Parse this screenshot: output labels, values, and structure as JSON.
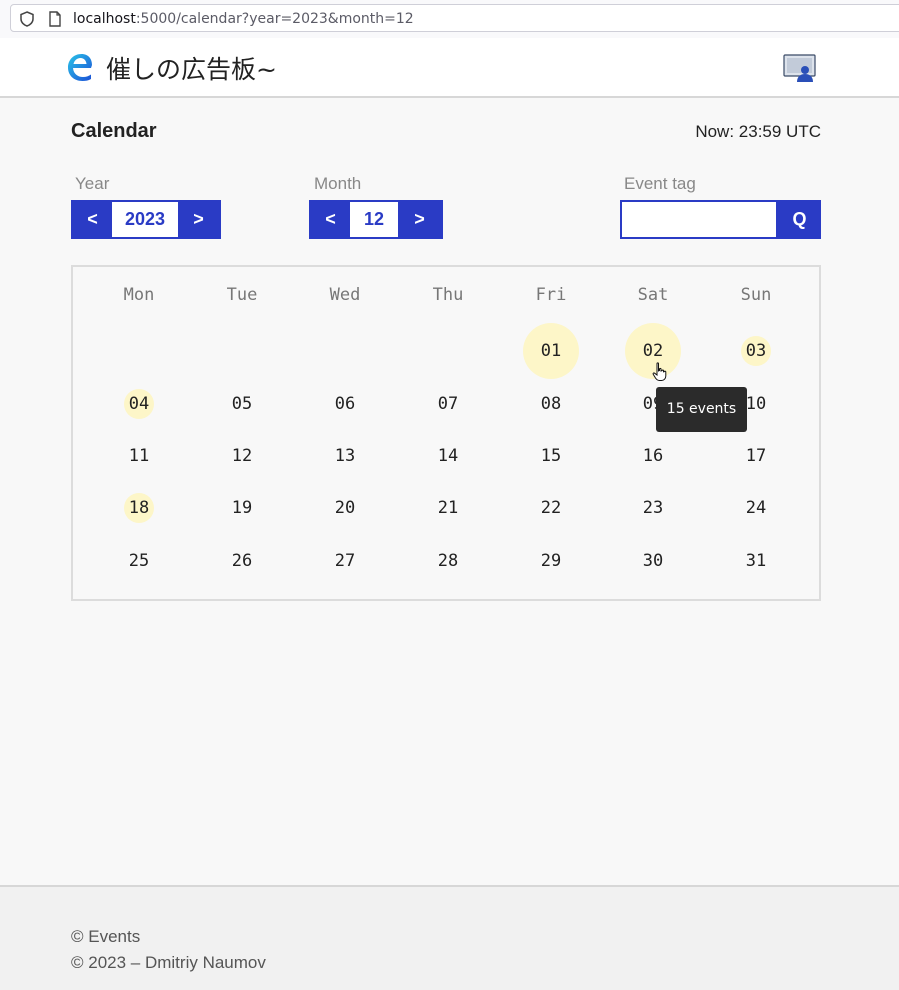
{
  "browser": {
    "url_host": "localhost",
    "url_rest": ":5000/calendar?year=2023&month=12"
  },
  "header": {
    "brand": "催しの広告板~"
  },
  "page": {
    "title": "Calendar",
    "now": "Now: 23:59 UTC"
  },
  "controls": {
    "year_label": "Year",
    "year_value": "2023",
    "month_label": "Month",
    "month_value": "12",
    "prev_label": "<",
    "next_label": ">",
    "tag_label": "Event tag",
    "tag_value": "",
    "search_label": "Q"
  },
  "calendar": {
    "weekdays": [
      "Mon",
      "Tue",
      "Wed",
      "Thu",
      "Fri",
      "Sat",
      "Sun"
    ],
    "weeks": [
      [
        "",
        "",
        "",
        "",
        "01",
        "02",
        "03"
      ],
      [
        "04",
        "05",
        "06",
        "07",
        "08",
        "09",
        "10"
      ],
      [
        "11",
        "12",
        "13",
        "14",
        "15",
        "16",
        "17"
      ],
      [
        "18",
        "19",
        "20",
        "21",
        "22",
        "23",
        "24"
      ],
      [
        "25",
        "26",
        "27",
        "28",
        "29",
        "30",
        "31"
      ]
    ],
    "highlighted_days": {
      "01": "large",
      "02": "large",
      "03": "small",
      "04": "small",
      "18": "small"
    },
    "highlight_color": "#fdf6c8"
  },
  "tooltip": {
    "text": "15 events"
  },
  "footer": {
    "line1": "© Events",
    "line2": "© 2023 – Dmitriy Naumov"
  },
  "colors": {
    "accent": "#2a3bc5"
  }
}
